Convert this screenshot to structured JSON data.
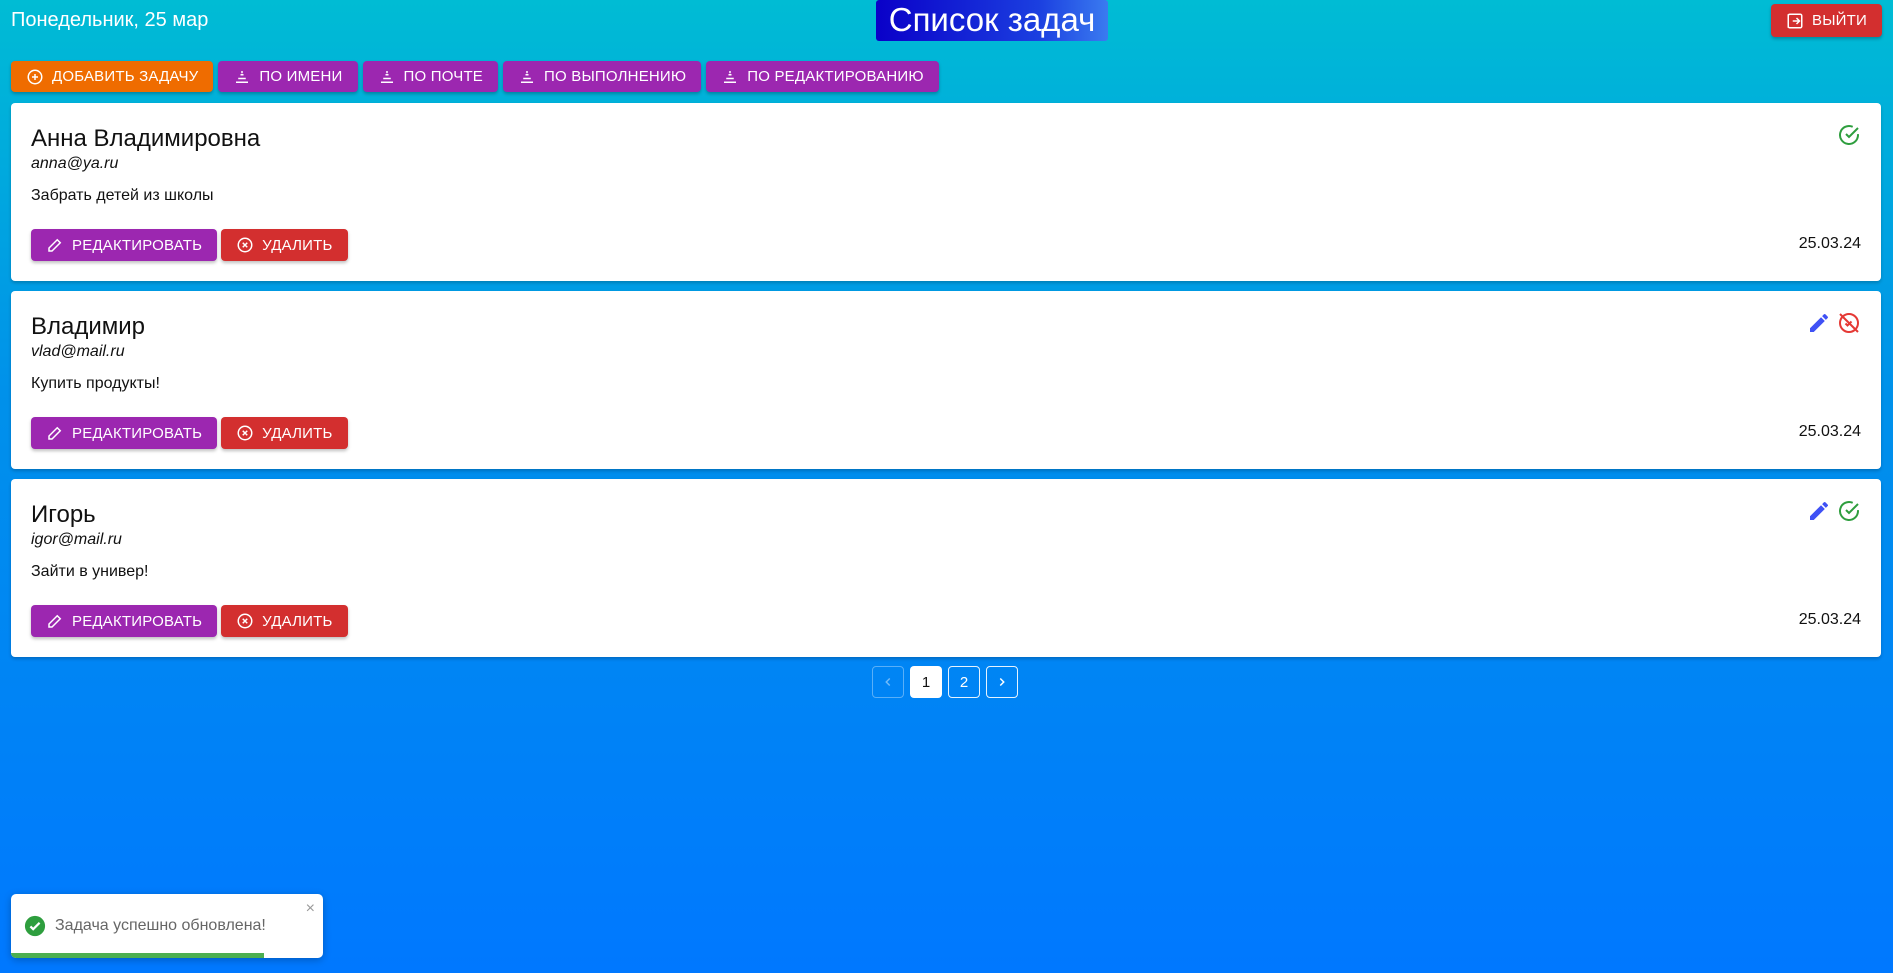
{
  "header": {
    "date": "Понедельник, 25 мар",
    "title": "Список задач",
    "logout_label": "Выйти"
  },
  "toolbar": {
    "add_label": "Добавить задачу",
    "sort_by_name": "По имени",
    "sort_by_email": "По почте",
    "sort_by_done": "По выполнению",
    "sort_by_edited": "По редактированию"
  },
  "card_actions": {
    "edit_label": "Редактировать",
    "delete_label": "Удалить"
  },
  "tasks": [
    {
      "name": "Анна Владимировна",
      "email": "anna@ya.ru",
      "text": "Забрать детей из школы",
      "date": "25.03.24",
      "edited": false,
      "done": true
    },
    {
      "name": "Владимир",
      "email": "vlad@mail.ru",
      "text": "Купить продукты!",
      "date": "25.03.24",
      "edited": true,
      "done": false
    },
    {
      "name": "Игорь",
      "email": "igor@mail.ru",
      "text": "Зайти в универ!",
      "date": "25.03.24",
      "edited": true,
      "done": true
    }
  ],
  "pagination": {
    "prev_icon": "chevron-left-icon",
    "pages": [
      "1",
      "2"
    ],
    "current": "1",
    "next_icon": "chevron-right-icon"
  },
  "toast": {
    "message": "Задача успешно обновлена!",
    "close_glyph": "×",
    "progress_fraction": 0.81
  },
  "colors": {
    "accent_purple": "#9c27b0",
    "accent_orange": "#ef6c00",
    "danger_red": "#d32f2f",
    "success_green": "#2e9e3e",
    "edit_blue": "#3f51f5",
    "undone_red": "#e53935"
  }
}
